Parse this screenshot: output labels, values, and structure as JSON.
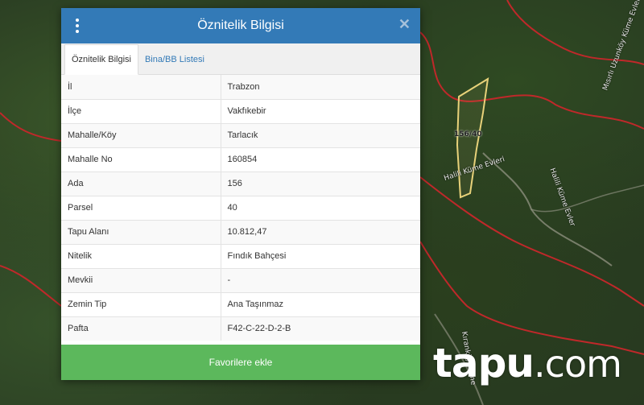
{
  "dialog": {
    "title": "Öznitelik Bilgisi",
    "tabs": [
      {
        "label": "Öznitelik Bilgisi",
        "active": true
      },
      {
        "label": "Bina/BB Listesi",
        "active": false
      }
    ],
    "rows": [
      {
        "key": "İl",
        "value": "Trabzon"
      },
      {
        "key": "İlçe",
        "value": "Vakfıkebir"
      },
      {
        "key": "Mahalle/Köy",
        "value": "Tarlacık"
      },
      {
        "key": "Mahalle No",
        "value": "160854"
      },
      {
        "key": "Ada",
        "value": "156"
      },
      {
        "key": "Parsel",
        "value": "40"
      },
      {
        "key": "Tapu Alanı",
        "value": "10.812,47"
      },
      {
        "key": "Nitelik",
        "value": "Fındık Bahçesi"
      },
      {
        "key": "Mevkii",
        "value": "-"
      },
      {
        "key": "Zemin Tip",
        "value": "Ana Taşınmaz"
      },
      {
        "key": "Pafta",
        "value": "F42-C-22-D-2-B"
      }
    ],
    "favorite_button": "Favorilere ekle"
  },
  "map": {
    "parcel_label": "156/40",
    "street_labels": [
      "Halili Küme Evleri",
      "Halili Küme Evler",
      "Mısırlı Uzunköy Küme Evler",
      "Kıranköy Küme"
    ]
  },
  "watermark": {
    "brand": "tapu",
    "suffix": ".com"
  },
  "colors": {
    "header": "#337ab7",
    "button": "#5cb85c",
    "boundary": "#c0282a",
    "parcel": "#e8d27a"
  }
}
